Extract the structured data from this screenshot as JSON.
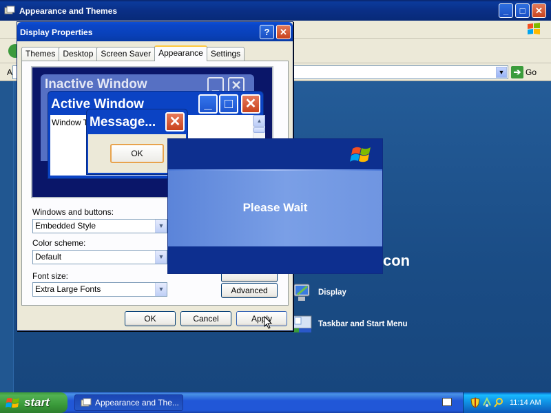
{
  "explorer": {
    "title": "Appearance and Themes",
    "address_label": "A",
    "go_label": "Go",
    "heading_partial": "con",
    "tasks": [
      {
        "label": "Display"
      },
      {
        "label": "Taskbar and Start Menu"
      }
    ]
  },
  "dialog": {
    "title": "Display Properties",
    "help_label": "?",
    "close_label": "✕",
    "tabs": [
      {
        "label": "Themes",
        "active": false
      },
      {
        "label": "Desktop",
        "active": false
      },
      {
        "label": "Screen Saver",
        "active": false
      },
      {
        "label": "Appearance",
        "active": true
      },
      {
        "label": "Settings",
        "active": false
      }
    ],
    "preview": {
      "inactive_title": "Inactive Window",
      "active_title": "Active Window",
      "window_text": "Window Text",
      "message_title": "Message...",
      "message_ok": "OK"
    },
    "fields": {
      "windows_buttons_label": "Windows and buttons:",
      "windows_buttons_value": "Embedded Style",
      "color_scheme_label": "Color scheme:",
      "color_scheme_value": "Default",
      "font_size_label": "Font size:",
      "font_size_value": "Extra Large Fonts"
    },
    "advanced_label": "Advanced",
    "ok_label": "OK",
    "cancel_label": "Cancel",
    "apply_label": "Apply"
  },
  "overlay": {
    "text": "Please Wait"
  },
  "taskbar": {
    "start_label": "start",
    "task_button_label": "Appearance and The...",
    "clock": "11:14 AM"
  },
  "colors": {
    "title_blue": "#0a46c9",
    "dialog_face": "#ece9d8",
    "start_green": "#3a9a3a",
    "taskbar_blue": "#2157d7"
  }
}
